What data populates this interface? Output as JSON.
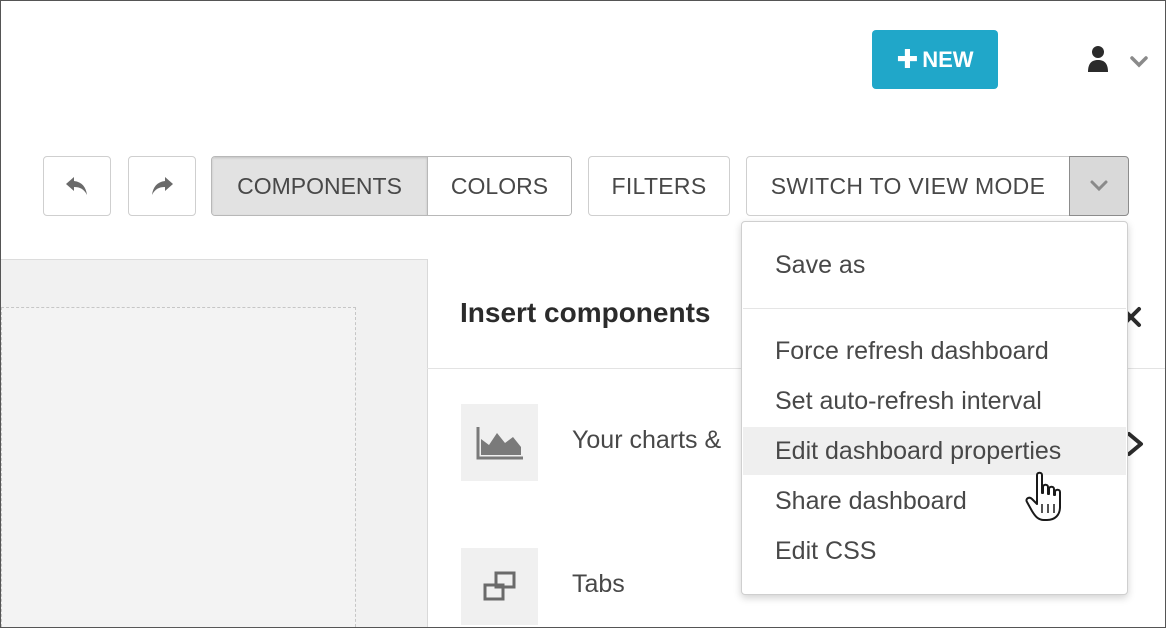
{
  "header": {
    "new_button_label": "NEW",
    "new_button_color": "#20a7c9"
  },
  "toolbar": {
    "components_label": "COMPONENTS",
    "colors_label": "COLORS",
    "filters_label": "FILTERS",
    "switch_mode_label": "SWITCH TO VIEW MODE"
  },
  "panel": {
    "title": "Insert components",
    "items": [
      {
        "label": "Your charts &",
        "icon": "area-chart-icon"
      },
      {
        "label": "Tabs",
        "icon": "tabs-icon"
      }
    ]
  },
  "menu": {
    "items": [
      {
        "label": "Save as"
      },
      {
        "label": "Force refresh dashboard"
      },
      {
        "label": "Set auto-refresh interval"
      },
      {
        "label": "Edit dashboard properties",
        "hovered": true
      },
      {
        "label": "Share dashboard"
      },
      {
        "label": "Edit CSS"
      }
    ]
  }
}
